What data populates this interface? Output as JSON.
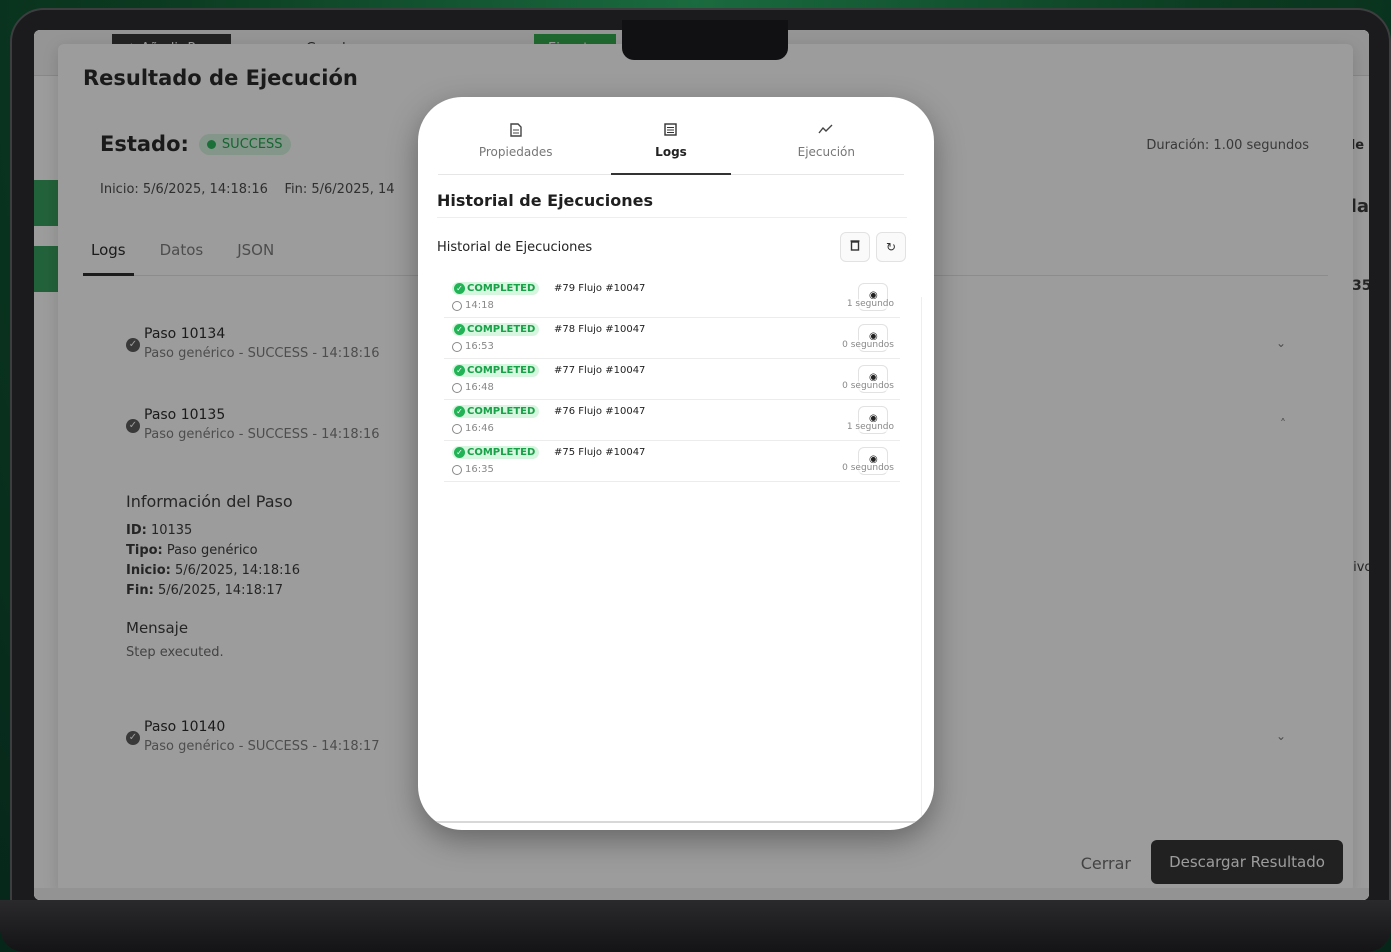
{
  "background_app": {
    "toolbar": {
      "add_step": "+ Añadir Paso",
      "save": "Guardar",
      "run": "Ejecutar"
    },
    "right_fragments": [
      "de",
      "da",
      "35",
      "tivo"
    ]
  },
  "result_dialog": {
    "title": "Resultado de Ejecución",
    "estado_label": "Estado:",
    "estado_value": "SUCCESS",
    "duracion": "Duración: 1.00 segundos",
    "inicio": "Inicio: 5/6/2025, 14:18:16",
    "fin": "Fin: 5/6/2025, 14",
    "tabs": [
      "Logs",
      "Datos",
      "JSON"
    ],
    "steps": [
      {
        "name": "Paso 10134",
        "sub": "Paso genérico - SUCCESS - 14:18:16"
      },
      {
        "name": "Paso 10135",
        "sub": "Paso genérico - SUCCESS - 14:18:16"
      },
      {
        "name": "Paso 10140",
        "sub": "Paso genérico - SUCCESS - 14:18:17"
      }
    ],
    "info": {
      "title": "Información del Paso",
      "id_label": "ID:",
      "id_value": "10135",
      "tipo_label": "Tipo:",
      "tipo_value": "Paso genérico",
      "inicio_label": "Inicio:",
      "inicio_value": "5/6/2025, 14:18:16",
      "fin_label": "Fin:",
      "fin_value": "5/6/2025, 14:18:17",
      "mensaje_title": "Mensaje",
      "mensaje_text": "Step executed."
    },
    "cerrar": "Cerrar",
    "descargar": "Descargar Resultado"
  },
  "panel": {
    "tabs": [
      {
        "label": "Propiedades",
        "icon": "document-icon"
      },
      {
        "label": "Logs",
        "icon": "list-icon"
      },
      {
        "label": "Ejecución",
        "icon": "chart-line-icon"
      }
    ],
    "heading": "Historial de Ejecuciones",
    "subheading": "Historial de Ejecuciones",
    "executions": [
      {
        "status": "COMPLETED",
        "title": "#79  Flujo #10047",
        "time": "14:18",
        "duration": "1 segundo"
      },
      {
        "status": "COMPLETED",
        "title": "#78  Flujo #10047",
        "time": "16:53",
        "duration": "0 segundos"
      },
      {
        "status": "COMPLETED",
        "title": "#77  Flujo #10047",
        "time": "16:48",
        "duration": "0 segundos"
      },
      {
        "status": "COMPLETED",
        "title": "#76  Flujo #10047",
        "time": "16:46",
        "duration": "1 segundo"
      },
      {
        "status": "COMPLETED",
        "title": "#75  Flujo #10047",
        "time": "16:35",
        "duration": "0 segundos"
      }
    ]
  },
  "colors": {
    "success_green": "#22b356",
    "badge_bg": "#d7f6df",
    "dark_button": "#2b2b2b"
  }
}
